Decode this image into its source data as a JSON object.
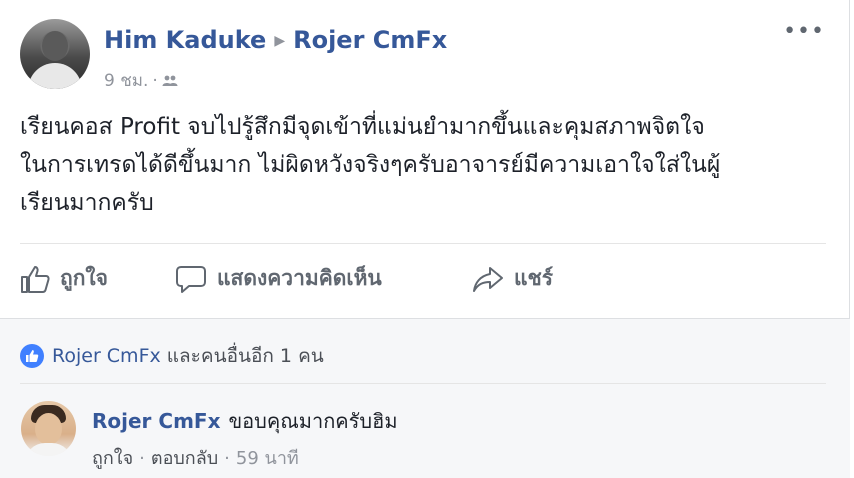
{
  "post": {
    "author": "Him Kaduke",
    "target": "Rojer CmFx",
    "time": "9 ชม.",
    "privacy_icon": "friends-icon",
    "more_label": "•••",
    "text_lines": [
      "เรียนคอส Profit จบไปรู้สึกมีจุดเข้าที่แม่นยำมากขึ้นและคุมสภาพจิตใจ",
      "ในการเทรดได้ดีขึ้นมาก ไม่ผิดหวังจริงๆครับอาจารย์มีความเอาใจใส่ในผู้",
      "เรียนมากครับ"
    ]
  },
  "actions": {
    "like": "ถูกใจ",
    "comment": "แสดงความคิดเห็น",
    "share": "แชร์"
  },
  "reactions": {
    "name": "Rojer CmFx",
    "rest": " และคนอื่นอีก 1 คน"
  },
  "comment": {
    "author": "Rojer CmFx",
    "text": "ขอบคุณมากครับฮิม",
    "like_label": "ถูกใจ",
    "reply_label": "ตอบกลับ",
    "time": "59 นาที"
  },
  "colors": {
    "link_blue": "#365899",
    "like_blue": "#4080ff",
    "meta_gray": "#90949c"
  }
}
